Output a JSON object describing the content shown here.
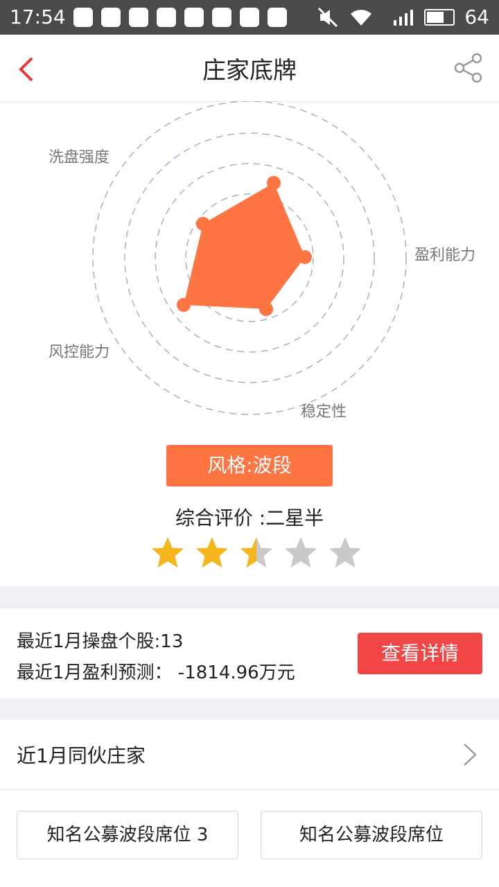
{
  "statusbar": {
    "time": "17:54",
    "battery": "64"
  },
  "header": {
    "title": "庄家底牌"
  },
  "radar": {
    "labels": [
      "洗盘强度",
      "盈利能力",
      "稳定性",
      "风控能力"
    ],
    "accent": "#ff7443"
  },
  "style_label": "风格:波段",
  "rating": {
    "text": "综合评价 :二星半",
    "stars": 2.5,
    "max": 5,
    "star_color": "#f7b51e",
    "empty_color": "#c9c9c9"
  },
  "stats": {
    "line1": "最近1月操盘个股:13",
    "line2": "最近1月盈利预测： -1814.96万元",
    "detail_button": "查看详情"
  },
  "partners": {
    "label": "近1月同伙庄家"
  },
  "chips": [
    "知名公募波段席位 3",
    "知名公募波段席位"
  ]
}
